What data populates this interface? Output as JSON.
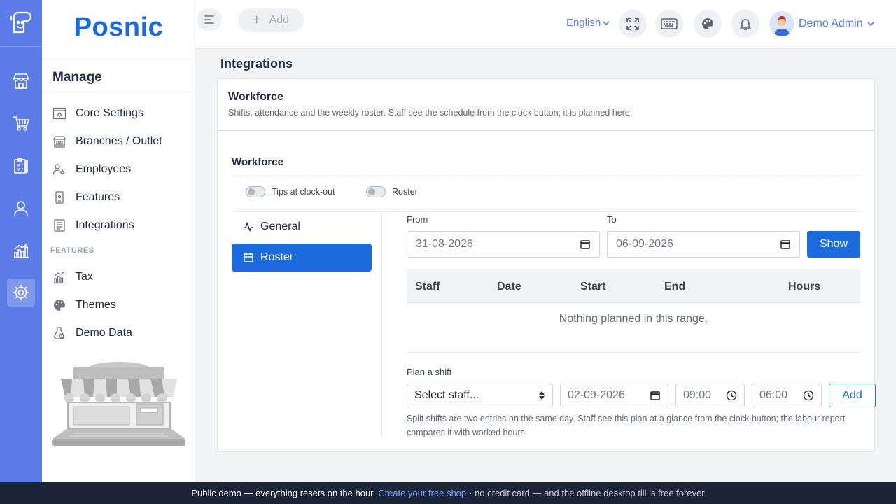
{
  "brand": {
    "name": "Posnic",
    "rail_icons": [
      "store-icon",
      "cart-icon",
      "clipboard-icon",
      "user-icon",
      "chart-icon",
      "settings-icon"
    ]
  },
  "sidebar": {
    "heading": "Manage",
    "items": [
      {
        "label": "Core Settings",
        "icon": "gear-window-icon"
      },
      {
        "label": "Branches / Outlet",
        "icon": "branch-store-icon"
      },
      {
        "label": "Employees",
        "icon": "employees-icon"
      },
      {
        "label": "Features",
        "icon": "device-icon"
      },
      {
        "label": "Integrations",
        "icon": "document-list-icon"
      }
    ],
    "section_label": "FEATURES",
    "feature_items": [
      {
        "label": "Tax",
        "icon": "tax-chart-icon"
      },
      {
        "label": "Themes",
        "icon": "palette-icon"
      },
      {
        "label": "Demo Data",
        "icon": "demo-data-icon"
      }
    ]
  },
  "topbar": {
    "add_label": "Add",
    "language": "English",
    "user_name": "Demo Admin",
    "icons": [
      "fullscreen-icon",
      "keyboard-icon",
      "palette-icon",
      "bell-icon"
    ]
  },
  "page": {
    "title": "Integrations"
  },
  "card": {
    "title": "Workforce",
    "subtitle": "Shifts, attendance and the weekly roster. Staff see the schedule from the clock button; it is planned here."
  },
  "workforce": {
    "section_title": "Workforce",
    "toggles": [
      {
        "label": "Tips at clock-out",
        "on": false
      },
      {
        "label": "Roster",
        "on": false
      }
    ],
    "tabs": [
      {
        "label": "General",
        "active": false
      },
      {
        "label": "Roster",
        "active": true
      }
    ]
  },
  "roster": {
    "from_label": "From",
    "from_value": "31-08-2026",
    "to_label": "To",
    "to_value": "06-09-2026",
    "show_label": "Show",
    "columns": [
      "Staff",
      "Date",
      "Start",
      "End",
      "Hours"
    ],
    "empty_message": "Nothing planned in this range.",
    "plan": {
      "label": "Plan a shift",
      "staff_placeholder": "Select staff...",
      "date_value": "02-09-2026",
      "start_value": "09:00",
      "end_value": "06:00",
      "add_label": "Add",
      "help": "Split shifts are two entries on the same day. Staff see this plan at a glance from the clock button; the labour report compares it with worked hours."
    }
  },
  "footer": {
    "text": "Public demo — everything resets on the hour.",
    "link": "Create your free shop",
    "rest": "· no credit card — and the offline desktop till is free forever"
  },
  "colors": {
    "rail": "#5b7ce6",
    "primary": "#1b6bdc",
    "footer": "#1c2438"
  }
}
